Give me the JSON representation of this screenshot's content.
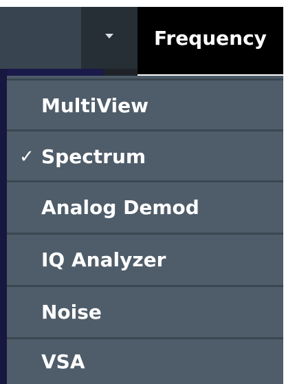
{
  "toolbar": {
    "dropdown_icon": "caret-down-icon",
    "active_tab_label": "Frequency"
  },
  "menu": {
    "items": [
      {
        "label": "MultiView",
        "checked": false,
        "check_mark": ""
      },
      {
        "label": "Spectrum",
        "checked": true,
        "check_mark": "✓"
      },
      {
        "label": "Analog Demod",
        "checked": false,
        "check_mark": ""
      },
      {
        "label": "IQ Analyzer",
        "checked": false,
        "check_mark": ""
      },
      {
        "label": "Noise",
        "checked": false,
        "check_mark": ""
      },
      {
        "label": "VSA",
        "checked": false,
        "check_mark": ""
      }
    ]
  },
  "colors": {
    "menu_bg": "#4f5d6a",
    "toolbar_bg": "#2b343d",
    "active_tab_bg": "#000000",
    "text": "#ffffff"
  }
}
